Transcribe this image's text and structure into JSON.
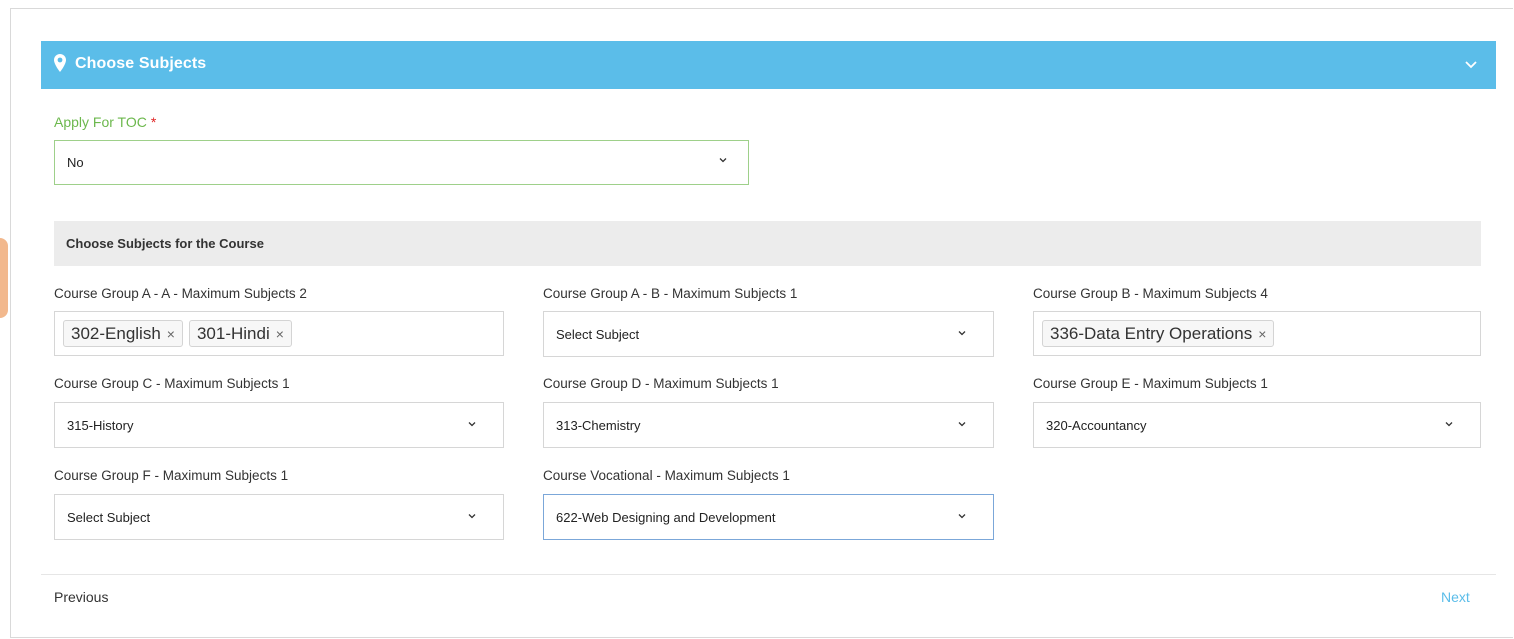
{
  "section": {
    "title": "Choose Subjects",
    "pin_icon": "map-pin-icon",
    "collapse_icon": "chevron-down-icon",
    "header_color": "#5bbde9"
  },
  "toc": {
    "label": "Apply For TOC",
    "required_mark": "*",
    "value": "No"
  },
  "subjects_section": {
    "title": "Choose Subjects for the Course"
  },
  "groups": {
    "a_a": {
      "label": "Course Group A - A - Maximum Subjects 2",
      "tags": [
        "302-English",
        "301-Hindi"
      ]
    },
    "a_b": {
      "label": "Course Group A - B - Maximum Subjects 1",
      "value": "Select Subject"
    },
    "b": {
      "label": "Course Group B - Maximum Subjects 4",
      "tags": [
        "336-Data Entry Operations"
      ]
    },
    "c": {
      "label": "Course Group C - Maximum Subjects 1",
      "value": "315-History"
    },
    "d": {
      "label": "Course Group D - Maximum Subjects 1",
      "value": "313-Chemistry"
    },
    "e": {
      "label": "Course Group E - Maximum Subjects 1",
      "value": "320-Accountancy"
    },
    "f": {
      "label": "Course Group F - Maximum Subjects 1",
      "value": "Select Subject"
    },
    "vocational": {
      "label": "Course Vocational - Maximum Subjects 1",
      "value": "622-Web Designing and Development"
    }
  },
  "tag_remove_symbol": "×",
  "nav": {
    "previous": "Previous",
    "next": "Next",
    "next_color": "#5bbde9"
  }
}
